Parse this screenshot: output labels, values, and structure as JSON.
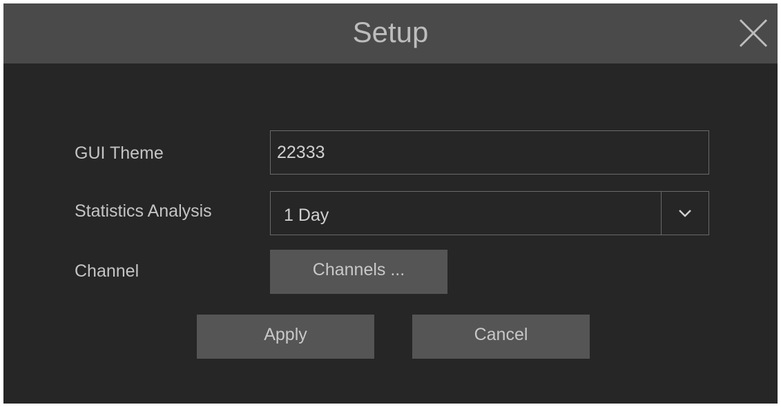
{
  "dialog": {
    "title": "Setup",
    "close_icon": "close-icon"
  },
  "form": {
    "gui_theme": {
      "label": "GUI Theme",
      "value": "22333"
    },
    "statistics_analysis": {
      "label": "Statistics Analysis",
      "selected": "1 Day",
      "dropdown_icon": "chevron-down-icon"
    },
    "channel": {
      "label": "Channel",
      "button_label": "Channels ..."
    }
  },
  "actions": {
    "apply_label": "Apply",
    "cancel_label": "Cancel"
  },
  "colors": {
    "dialog_background": "#262626",
    "titlebar_background": "#4a4a4a",
    "button_background": "#555555",
    "text": "#c4c4c4"
  }
}
